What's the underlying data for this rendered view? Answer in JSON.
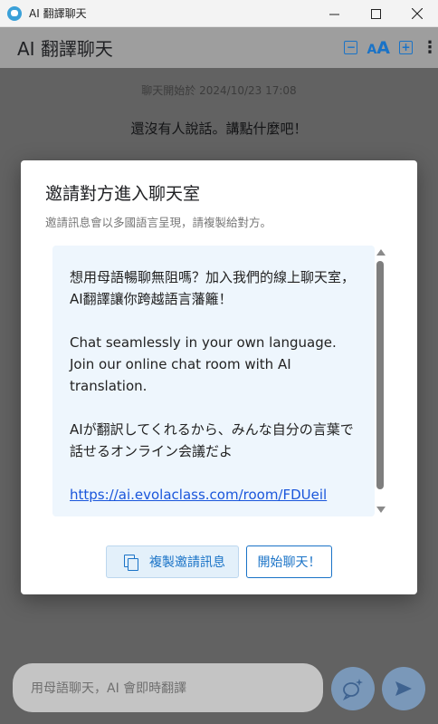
{
  "window": {
    "title": "AI 翻譯聊天",
    "controls": [
      "minimize-icon",
      "maximize-icon",
      "close-icon"
    ]
  },
  "header": {
    "title": "AI 翻譯聊天",
    "font_decrease": "−",
    "font_label_small": "A",
    "font_label_large": "A",
    "font_increase": "+",
    "menu": "⋮"
  },
  "chat": {
    "meta": "聊天開始於 2024/10/23 17:08",
    "empty_message": "還沒有人說話。講點什麼吧！"
  },
  "input": {
    "placeholder": "用母語聊天，AI 會即時翻譯"
  },
  "dialog": {
    "title": "邀請對方進入聊天室",
    "subtitle": "邀請訊息會以多國語言呈現，請複製給對方。",
    "invite": {
      "zh": "想用母語暢聊無阻嗎？加入我們的線上聊天室，AI翻譯讓你跨越語言藩籬！",
      "en": "Chat seamlessly in your own language. Join our online chat room with AI translation.",
      "ja": "AIが翻訳してくれるから、みんな自分の言葉で話せるオンライン会議だよ",
      "link": "https://ai.evolaclass.com/room/FDUeil"
    },
    "copy_button": "複製邀請訊息",
    "start_button": "開始聊天！"
  },
  "colors": {
    "accent": "#1a73c7",
    "invite_background": "#eef6fd"
  }
}
